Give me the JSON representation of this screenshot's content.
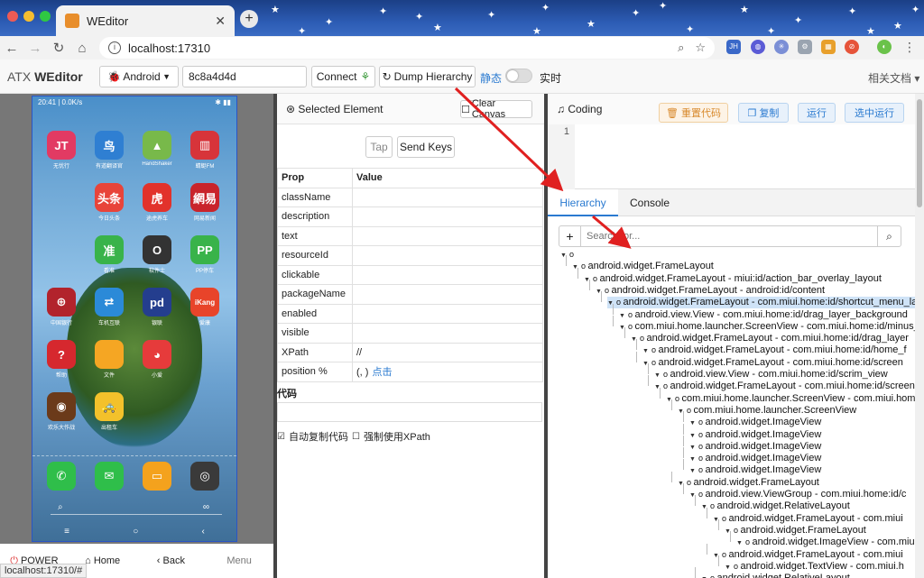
{
  "browser": {
    "tab_title": "WEditor",
    "url": "localhost:17310",
    "status_url": "localhost:17310/#"
  },
  "header": {
    "brand_prefix": "ATX",
    "brand_name": "WEditor",
    "platform": "Android",
    "device_id": "8c8a4d4d",
    "connect_label": "Connect",
    "dump_label": "Dump Hierarchy",
    "static_label": "静态",
    "realtime_label": "实时",
    "docs_label": "相关文档"
  },
  "phone": {
    "status_time": "20:41 | 0.0K/s",
    "apps": [
      {
        "label": "无忧行",
        "glyph": "JT",
        "color": "#e23a63"
      },
      {
        "label": "有道翻译官",
        "glyph": "鸟",
        "color": "#2f7fd2"
      },
      {
        "label": "HandShaker",
        "glyph": "▲",
        "color": "#78b94a"
      },
      {
        "label": "蜻蜓FM",
        "glyph": "▥",
        "color": "#d7343a"
      },
      {
        "label": "今日头条",
        "glyph": "头条",
        "color": "#e8443a"
      },
      {
        "label": "途虎养车",
        "glyph": "虎",
        "color": "#e2322b"
      },
      {
        "label": "网易新闻",
        "glyph": "網易",
        "color": "#c9242b"
      },
      {
        "label": "看准",
        "glyph": "准",
        "color": "#39b34a"
      },
      {
        "label": "软件士",
        "glyph": "O",
        "color": "#333333"
      },
      {
        "label": "PP停车",
        "glyph": "PP",
        "color": "#39b34a"
      },
      {
        "label": "中国银行",
        "glyph": "⊕",
        "color": "#b2232c"
      },
      {
        "label": "车机互联",
        "glyph": "⇄",
        "color": "#2b8ad8"
      },
      {
        "label": "银联",
        "glyph": "pd",
        "color": "#243e8e"
      },
      {
        "label": "爱康",
        "glyph": "iKang",
        "color": "#e8442a"
      },
      {
        "label": "帮助",
        "glyph": "?",
        "color": "#d6282e"
      },
      {
        "label": "文件",
        "glyph": "",
        "color": "#f5a623"
      },
      {
        "label": "小爱",
        "glyph": "◕",
        "color": "#e63b3b"
      },
      {
        "label": "欢乐大作战",
        "glyph": "◉",
        "color": "#6b3a1a"
      },
      {
        "label": "出租车",
        "glyph": "🚕",
        "color": "#f3c12b"
      }
    ],
    "dock": [
      {
        "glyph": "✆",
        "color": "#2fbe4a"
      },
      {
        "glyph": "✉",
        "color": "#2fbe4a"
      },
      {
        "glyph": "▭",
        "color": "#f4a21d"
      },
      {
        "glyph": "◎",
        "color": "#3a3a3a"
      }
    ],
    "controls": {
      "power": "POWER",
      "home": "Home",
      "back": "Back",
      "menu": "Menu"
    }
  },
  "middle": {
    "title": "Selected Element",
    "clear_label": "Clear Canvas",
    "tap_label": "Tap",
    "sendkeys_label": "Send Keys",
    "col_prop": "Prop",
    "col_value": "Value",
    "rows": [
      {
        "prop": "className",
        "value": ""
      },
      {
        "prop": "description",
        "value": ""
      },
      {
        "prop": "text",
        "value": ""
      },
      {
        "prop": "resourceId",
        "value": ""
      },
      {
        "prop": "clickable",
        "value": ""
      },
      {
        "prop": "packageName",
        "value": ""
      },
      {
        "prop": "enabled",
        "value": ""
      },
      {
        "prop": "visible",
        "value": ""
      },
      {
        "prop": "XPath",
        "value": "//"
      },
      {
        "prop": "position %",
        "value": "(, )"
      }
    ],
    "position_link": "点击",
    "code_label": "代码",
    "auto_copy_label": "自动复制代码",
    "force_xpath_label": "强制使用XPath"
  },
  "right": {
    "coding_label": "Coding",
    "reset_label": "重置代码",
    "copy_label": "复制",
    "run_label": "运行",
    "run_selected_label": "选中运行",
    "line_number": "1",
    "tab_hierarchy": "Hierarchy",
    "tab_console": "Console",
    "search_placeholder": "Search for...",
    "tree": [
      {
        "d": 0,
        "text": ""
      },
      {
        "d": 1,
        "text": "android.widget.FrameLayout"
      },
      {
        "d": 2,
        "text": "android.widget.FrameLayout - miui:id/action_bar_overlay_layout"
      },
      {
        "d": 3,
        "text": "android.widget.FrameLayout - android:id/content"
      },
      {
        "d": 4,
        "text": "android.widget.FrameLayout - com.miui.home:id/shortcut_menu_layer",
        "sel": true
      },
      {
        "d": 5,
        "text": "android.view.View - com.miui.home:id/drag_layer_background"
      },
      {
        "d": 5,
        "text": "com.miui.home.launcher.ScreenView - com.miui.home:id/minus_screen"
      },
      {
        "d": 6,
        "text": "android.widget.FrameLayout - com.miui.home:id/drag_layer"
      },
      {
        "d": 7,
        "text": "android.widget.FrameLayout - com.miui.home:id/home_f"
      },
      {
        "d": 7,
        "text": "android.widget.FrameLayout - com.miui.home:id/screen"
      },
      {
        "d": 8,
        "text": "android.view.View - com.miui.home:id/scrim_view"
      },
      {
        "d": 8,
        "text": "android.widget.FrameLayout - com.miui.home:id/screen"
      },
      {
        "d": 9,
        "text": "com.miui.home.launcher.ScreenView - com.miui.home"
      },
      {
        "d": 10,
        "text": "com.miui.home.launcher.ScreenView"
      },
      {
        "d": 11,
        "text": "android.widget.ImageView"
      },
      {
        "d": 11,
        "text": "android.widget.ImageView"
      },
      {
        "d": 11,
        "text": "android.widget.ImageView"
      },
      {
        "d": 11,
        "text": "android.widget.ImageView"
      },
      {
        "d": 11,
        "text": "android.widget.ImageView"
      },
      {
        "d": 10,
        "text": "android.widget.FrameLayout"
      },
      {
        "d": 11,
        "text": "android.view.ViewGroup - com.miui.home:id/c"
      },
      {
        "d": 12,
        "text": "android.widget.RelativeLayout"
      },
      {
        "d": 13,
        "text": "android.widget.FrameLayout - com.miui"
      },
      {
        "d": 14,
        "text": "android.widget.FrameLayout"
      },
      {
        "d": 15,
        "text": "android.widget.ImageView - com.miui"
      },
      {
        "d": 13,
        "text": "android.widget.FrameLayout - com.miui"
      },
      {
        "d": 14,
        "text": "android.widget.TextView - com.miui.h"
      },
      {
        "d": 12,
        "text": "android.widget.RelativeLayout"
      }
    ]
  },
  "colors": {
    "accent": "#2a7ad0",
    "selection": "#cfe3f7",
    "arrow": "#e02020"
  }
}
